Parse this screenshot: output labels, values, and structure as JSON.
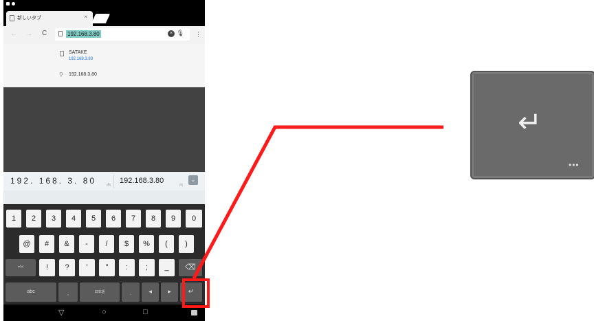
{
  "browser": {
    "tab_title": "新しいタブ",
    "tab_close": "×",
    "reload_icon": "C",
    "url": "192.168.3.80",
    "suggestions": [
      {
        "title": "SATAKE",
        "url": "192.168.3.80"
      },
      {
        "text": "192.168.3.80"
      }
    ]
  },
  "ime": {
    "candidate_1": "192. 168. 3. 80",
    "candidate_2": "192.168.3.80",
    "mark_1": "[数]",
    "mark_2": "[半]"
  },
  "keyboard": {
    "row1": [
      "1",
      "2",
      "3",
      "4",
      "5",
      "6",
      "7",
      "8",
      "9",
      "0"
    ],
    "row2": [
      "@",
      "#",
      "&",
      "-",
      "/",
      "$",
      "%",
      "(",
      ")"
    ],
    "row3": [
      "=\\<",
      "!",
      "?",
      "'",
      "\"",
      ":",
      ";",
      "_",
      "⌫"
    ],
    "row4": [
      "abc",
      ",",
      "日本語",
      ".",
      "◀",
      "▶",
      "↵"
    ]
  },
  "navbar": [
    "▽",
    "○",
    "□"
  ],
  "zoom": {
    "arrow": "↵",
    "dots": "•••"
  },
  "colors": {
    "highlight": "#ff1a1a",
    "url_selection": "#80cbc4",
    "suggest_url": "#1a73e8",
    "keyboard_bg": "#2b2b2b"
  }
}
